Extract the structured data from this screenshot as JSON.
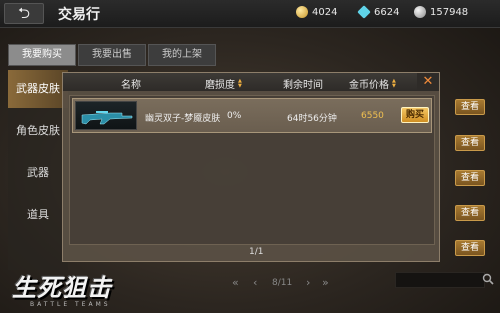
{
  "header": {
    "title": "交易行",
    "back_icon": "back-arrow-icon",
    "currencies": [
      {
        "icon": "coin-icon",
        "value": "4024"
      },
      {
        "icon": "diamond-icon",
        "value": "6624"
      },
      {
        "icon": "silver-coin-icon",
        "value": "157948"
      }
    ]
  },
  "tabs": [
    {
      "label": "我要购买",
      "active": true
    },
    {
      "label": "我要出售",
      "active": false
    },
    {
      "label": "我的上架",
      "active": false
    }
  ],
  "sidebar": {
    "items": [
      {
        "label": "武器皮肤",
        "active": true
      },
      {
        "label": "角色皮肤",
        "active": false
      },
      {
        "label": "武器",
        "active": false
      },
      {
        "label": "道具",
        "active": false
      }
    ]
  },
  "view_buttons": [
    "查看",
    "查看",
    "查看",
    "查看",
    "查看"
  ],
  "pagination": {
    "first": "«",
    "prev": "‹",
    "page": "8/11",
    "next": "›",
    "last": "»"
  },
  "logo": {
    "main": "生死狙击",
    "sub": "BATTLE TEAMS"
  },
  "modal": {
    "columns": {
      "name": "名称",
      "wear": "磨损度",
      "time_left": "剩余时间",
      "price": "金币价格"
    },
    "close_label": "✕",
    "rows": [
      {
        "name": "幽灵双子-梦魇皮肤",
        "wear": "0%",
        "time_left": "64时56分钟",
        "price": "6550",
        "buy_label": "购买"
      }
    ],
    "page": "1/1"
  },
  "colors": {
    "accent_gold": "#f0c050",
    "buy_button": "#e0a535",
    "close_orange": "#f08a3a"
  }
}
